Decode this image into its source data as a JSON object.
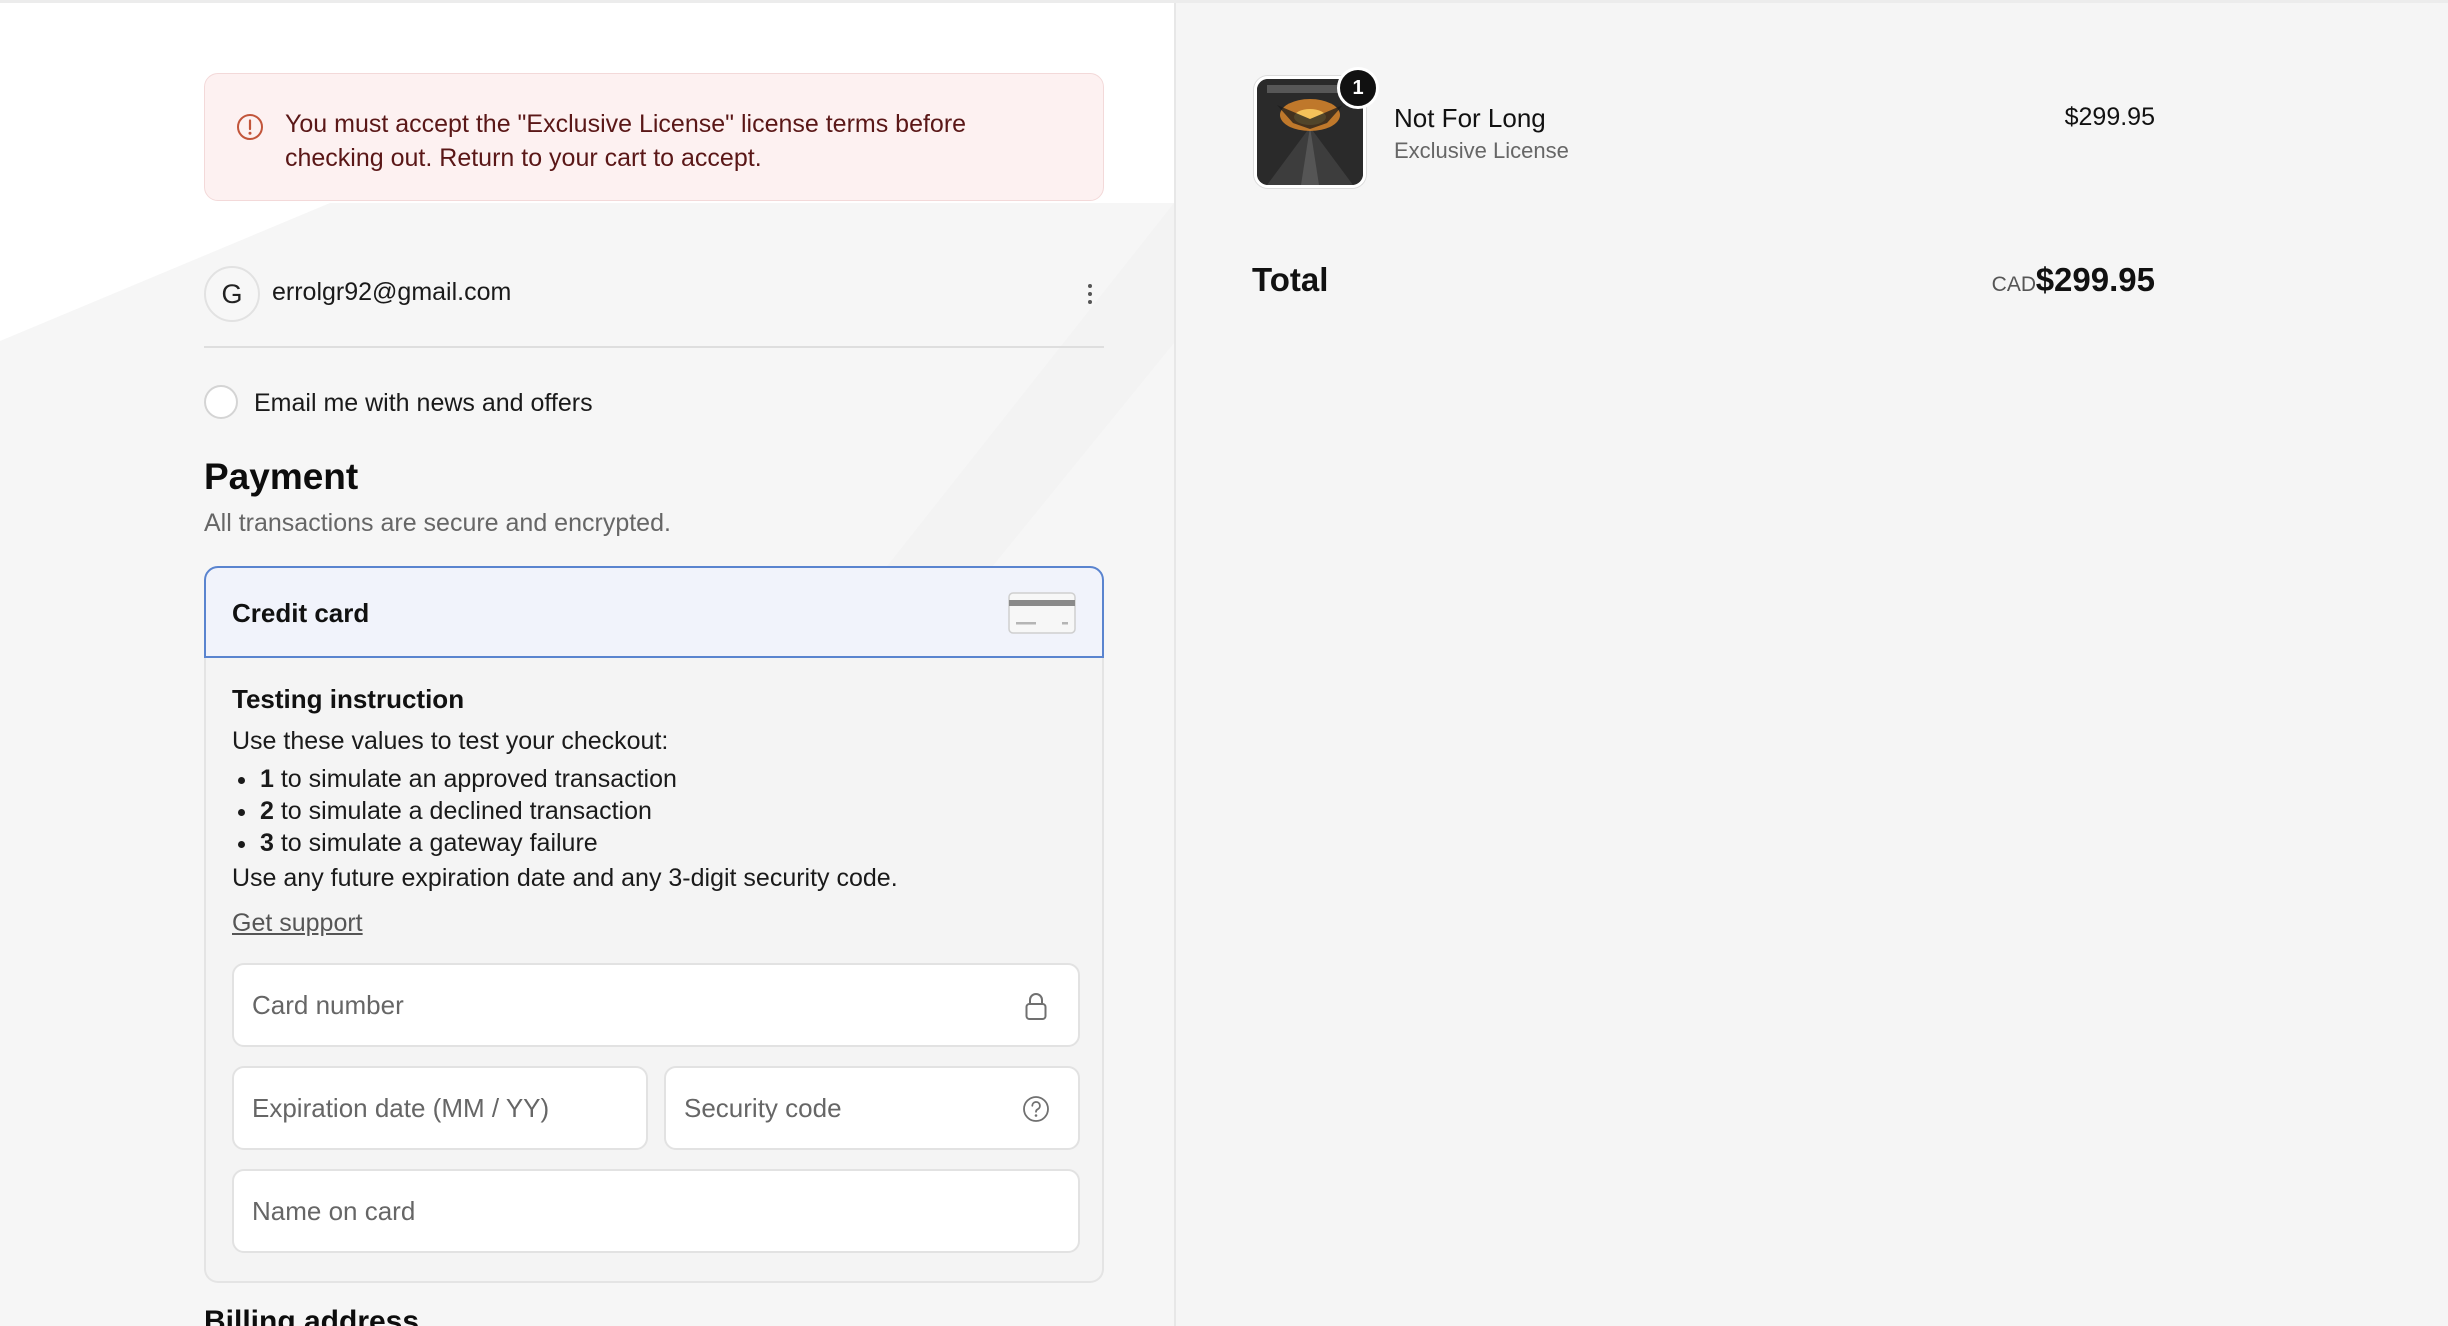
{
  "alert": {
    "message": "You must accept the \"Exclusive License\" license terms before checking out. Return to your cart to accept."
  },
  "account": {
    "avatar_initial": "G",
    "email": "errolgr92@gmail.com"
  },
  "marketing": {
    "label": "Email me with news and offers",
    "checked": false
  },
  "payment": {
    "title": "Payment",
    "subtitle": "All transactions are secure and encrypted.",
    "method_label": "Credit card",
    "testing": {
      "title": "Testing instruction",
      "intro": "Use these values to test your checkout:",
      "items": [
        {
          "code": "1",
          "text": " to simulate an approved transaction"
        },
        {
          "code": "2",
          "text": " to simulate a declined transaction"
        },
        {
          "code": "3",
          "text": " to simulate a gateway failure"
        }
      ],
      "outro": "Use any future expiration date and any 3-digit security code.",
      "support_link": "Get support"
    },
    "fields": {
      "card_number_placeholder": "Card number",
      "expiration_placeholder": "Expiration date (MM / YY)",
      "security_code_placeholder": "Security code",
      "name_on_card_placeholder": "Name on card"
    }
  },
  "billing": {
    "title": "Billing address"
  },
  "summary": {
    "item": {
      "quantity": "1",
      "name": "Not For Long",
      "variant": "Exclusive License",
      "price": "$299.95"
    },
    "total_label": "Total",
    "currency": "CAD",
    "total_amount": "$299.95"
  },
  "colors": {
    "alert_bg": "#fdf1f1",
    "alert_text": "#5a1717",
    "selected_border": "#5a84cf",
    "selected_bg": "#f1f3fb"
  }
}
